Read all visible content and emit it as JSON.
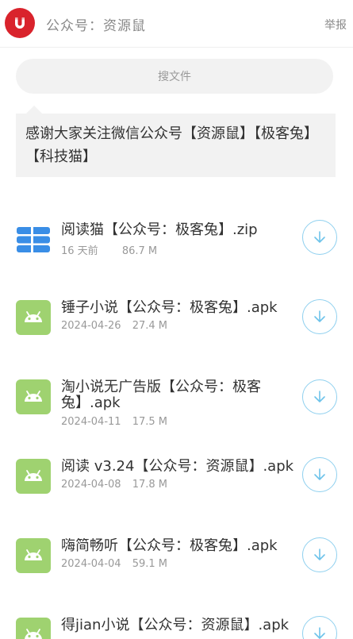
{
  "header": {
    "title": "公众号：资源鼠",
    "report_label": "举报"
  },
  "search": {
    "label": "搜文件"
  },
  "notice": {
    "text": "感谢大家关注微信公众号【资源鼠】【极客兔】【科技猫】"
  },
  "files": [
    {
      "name": "阅读猫【公众号：极客兔】.zip",
      "date": "16 天前",
      "size": "86.7 M",
      "icon": "zip-file-icon"
    },
    {
      "name": "锤子小说【公众号：极客兔】.apk",
      "date": "2024-04-26",
      "size": "27.4 M",
      "icon": "android-app-icon"
    },
    {
      "name": "淘小说无广告版【公众号：极客兔】.apk",
      "date": "2024-04-11",
      "size": "17.5 M",
      "icon": "android-app-icon"
    },
    {
      "name": "阅读 v3.24【公众号：资源鼠】.apk",
      "date": "2024-04-08",
      "size": "17.8 M",
      "icon": "android-app-icon"
    },
    {
      "name": "嗨简畅听【公众号：极客兔】.apk",
      "date": "2024-04-04",
      "size": "59.1 M",
      "icon": "android-app-icon"
    },
    {
      "name": "得jian小说【公众号：资源鼠】.apk",
      "date": "",
      "size": "",
      "icon": "android-app-icon"
    }
  ],
  "colors": {
    "avatar": "#d9232c",
    "android_icon": "#9fd270",
    "zip_icon": "#3a8ee6",
    "download_accent": "#8fd0ef"
  }
}
